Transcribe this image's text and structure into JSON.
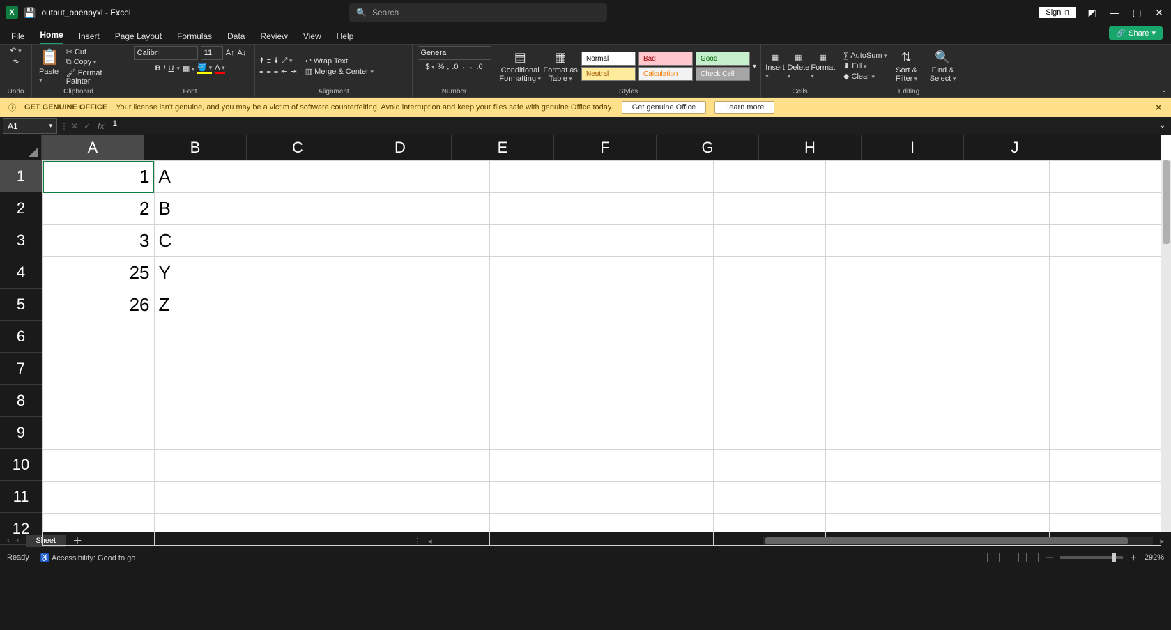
{
  "title": {
    "document": "output_openpyxl",
    "app": "Excel"
  },
  "search": {
    "placeholder": "Search"
  },
  "titlebar_right": {
    "signin": "Sign in"
  },
  "menu": {
    "tabs": [
      "File",
      "Home",
      "Insert",
      "Page Layout",
      "Formulas",
      "Data",
      "Review",
      "View",
      "Help"
    ],
    "active": "Home",
    "share": "Share"
  },
  "ribbon": {
    "undo_group": "Undo",
    "clipboard": {
      "paste": "Paste",
      "cut": "Cut",
      "copy": "Copy",
      "painter": "Format Painter",
      "label": "Clipboard"
    },
    "font": {
      "name": "Calibri",
      "size": "11",
      "label": "Font"
    },
    "alignment": {
      "wrap": "Wrap Text",
      "merge": "Merge & Center",
      "label": "Alignment"
    },
    "number": {
      "format": "General",
      "label": "Number"
    },
    "styles": {
      "cond": "Conditional Formatting",
      "formatastable": "Format as Table",
      "cells": {
        "normal": "Normal",
        "bad": "Bad",
        "good": "Good",
        "neutral": "Neutral",
        "calc": "Calculation",
        "check": "Check Cell"
      },
      "label": "Styles"
    },
    "cells_group": {
      "insert": "Insert",
      "delete": "Delete",
      "format": "Format",
      "label": "Cells"
    },
    "editing": {
      "autosum": "AutoSum",
      "fill": "Fill",
      "clear": "Clear",
      "sort": "Sort & Filter",
      "find": "Find & Select",
      "label": "Editing"
    }
  },
  "warning": {
    "title": "GET GENUINE OFFICE",
    "text": "Your license isn't genuine, and you may be a victim of software counterfeiting. Avoid interruption and keep your files safe with genuine Office today.",
    "btn_get": "Get genuine Office",
    "btn_learn": "Learn more"
  },
  "formula": {
    "name": "A1",
    "fx": "fx",
    "value": "1"
  },
  "grid": {
    "columns": [
      "A",
      "B",
      "C",
      "D",
      "E",
      "F",
      "G",
      "H",
      "I",
      "J"
    ],
    "rows": [
      "1",
      "2",
      "3",
      "4",
      "5",
      "6",
      "7",
      "8",
      "9",
      "10",
      "11",
      "12"
    ],
    "active_col": "A",
    "active_row": "1",
    "data": [
      {
        "r": 0,
        "c": 0,
        "v": "1",
        "t": "num"
      },
      {
        "r": 0,
        "c": 1,
        "v": "A",
        "t": "txt"
      },
      {
        "r": 1,
        "c": 0,
        "v": "2",
        "t": "num"
      },
      {
        "r": 1,
        "c": 1,
        "v": "B",
        "t": "txt"
      },
      {
        "r": 2,
        "c": 0,
        "v": "3",
        "t": "num"
      },
      {
        "r": 2,
        "c": 1,
        "v": "C",
        "t": "txt"
      },
      {
        "r": 3,
        "c": 0,
        "v": "25",
        "t": "num"
      },
      {
        "r": 3,
        "c": 1,
        "v": "Y",
        "t": "txt"
      },
      {
        "r": 4,
        "c": 0,
        "v": "26",
        "t": "num"
      },
      {
        "r": 4,
        "c": 1,
        "v": "Z",
        "t": "txt"
      }
    ]
  },
  "sheets": {
    "active": "Sheet"
  },
  "status": {
    "ready": "Ready",
    "access": "Accessibility: Good to go",
    "zoom": "292%"
  }
}
